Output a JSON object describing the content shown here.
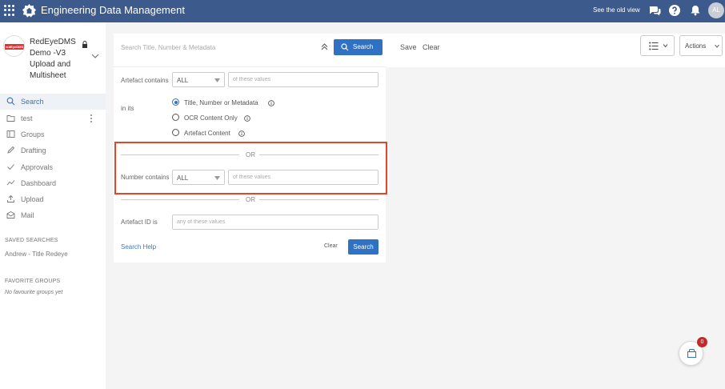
{
  "header": {
    "app_title": "Engineering Data Management",
    "old_view_link": "See the old view",
    "avatar_initials": "AL",
    "color": "#3c5a8c"
  },
  "sidebar": {
    "tenant": {
      "name": "RedEyeDMS Demo -V3 Upload and Multisheet",
      "logo_text": "redEyeDMS"
    },
    "items": [
      {
        "label": "Search",
        "icon": "search-icon",
        "active": true
      },
      {
        "label": "test",
        "icon": "folder-icon",
        "active": false
      },
      {
        "label": "Groups",
        "icon": "groups-icon",
        "active": false
      },
      {
        "label": "Drafting",
        "icon": "pencil-icon",
        "active": false
      },
      {
        "label": "Approvals",
        "icon": "check-icon",
        "active": false
      },
      {
        "label": "Dashboard",
        "icon": "chart-line-icon",
        "active": false
      },
      {
        "label": "Upload",
        "icon": "upload-icon",
        "active": false
      },
      {
        "label": "Mail",
        "icon": "mail-icon",
        "active": false
      }
    ],
    "saved_searches": {
      "heading": "SAVED SEARCHES",
      "items": [
        "Andrew - Title Redeye"
      ]
    },
    "favorite_groups": {
      "heading": "FAVORITE GROUPS",
      "empty_text": "No favourite groups yet"
    }
  },
  "toolbar": {
    "save_label": "Save",
    "clear_label": "Clear",
    "actions_label": "Actions"
  },
  "search_panel": {
    "placeholder": "Search Title, Number & Metadata",
    "search_button": "Search",
    "artefact_contains": {
      "label": "Artefact contains",
      "operator": "ALL",
      "value_placeholder": "of these values"
    },
    "in_its": {
      "label": "in its",
      "options": [
        {
          "label": "Title, Number or Metadata",
          "checked": true
        },
        {
          "label": "OCR Content Only",
          "checked": false
        },
        {
          "label": "Artefact Content",
          "checked": false
        }
      ]
    },
    "or_label": "OR",
    "number_contains": {
      "label": "Number contains",
      "operator": "ALL",
      "value_placeholder": "of these values"
    },
    "or_label_2": "OR",
    "artefact_id": {
      "label": "Artefact ID is",
      "value_placeholder": "any of these values"
    },
    "help_link": "Search Help",
    "clear_button": "Clear",
    "search_button_bottom": "Search",
    "accent_color": "#2f72c4",
    "highlight_color": "#e0462a"
  },
  "basket": {
    "count": "0"
  }
}
